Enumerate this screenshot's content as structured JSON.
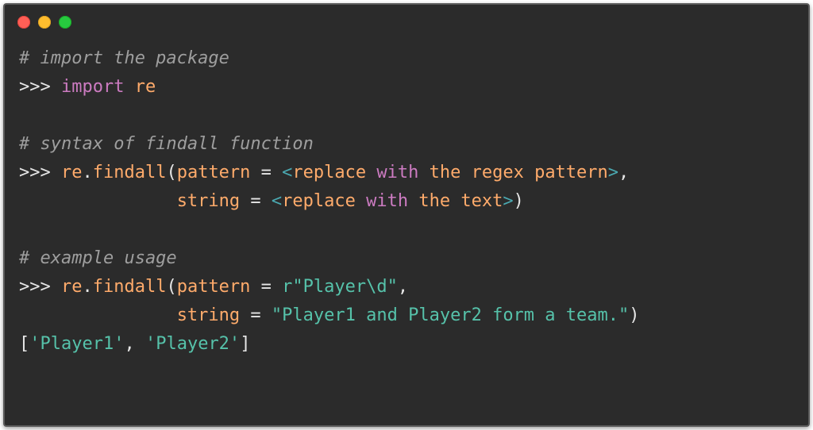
{
  "titlebar": {
    "buttons": [
      "close",
      "minimize",
      "zoom"
    ],
    "colors": {
      "close": "#ff5f56",
      "minimize": "#ffbd2e",
      "zoom": "#27c93f"
    }
  },
  "code": {
    "comment1": "# import the package",
    "line2_prompt": ">>> ",
    "line2_import": "import",
    "line2_re": "re",
    "comment2": "# syntax of findall function",
    "line4_prompt": ">>> ",
    "line4_re": "re",
    "line4_dot": ".",
    "line4_findall": "findall",
    "line4_lparen": "(",
    "line4_pattern": "pattern",
    "line4_eq": " = ",
    "line4_lt": "<",
    "line4_replace": "replace ",
    "line4_with": "with",
    "line4_the_regex_pattern": " the regex pattern",
    "line4_gt": ">",
    "line4_comma": ",",
    "line5_pad": "               ",
    "line5_string": "string",
    "line5_eq": " = ",
    "line5_lt": "<",
    "line5_replace": "replace ",
    "line5_with": "with",
    "line5_the_text": " the text",
    "line5_gt": ">",
    "line5_rparen": ")",
    "comment3": "# example usage",
    "line7_prompt": ">>> ",
    "line7_re": "re",
    "line7_dot": ".",
    "line7_findall": "findall",
    "line7_lparen": "(",
    "line7_pattern": "pattern",
    "line7_eq": " = ",
    "line7_str_prefix": "r",
    "line7_str": "\"Player\\d\"",
    "line7_comma": ",",
    "line8_pad": "               ",
    "line8_string": "string",
    "line8_eq": " = ",
    "line8_str": "\"Player1 and Player2 form a team.\"",
    "line8_rparen": ")",
    "line9_lb": "[",
    "line9_item1": "'Player1'",
    "line9_sep": ", ",
    "line9_item2": "'Player2'",
    "line9_rb": "]"
  }
}
